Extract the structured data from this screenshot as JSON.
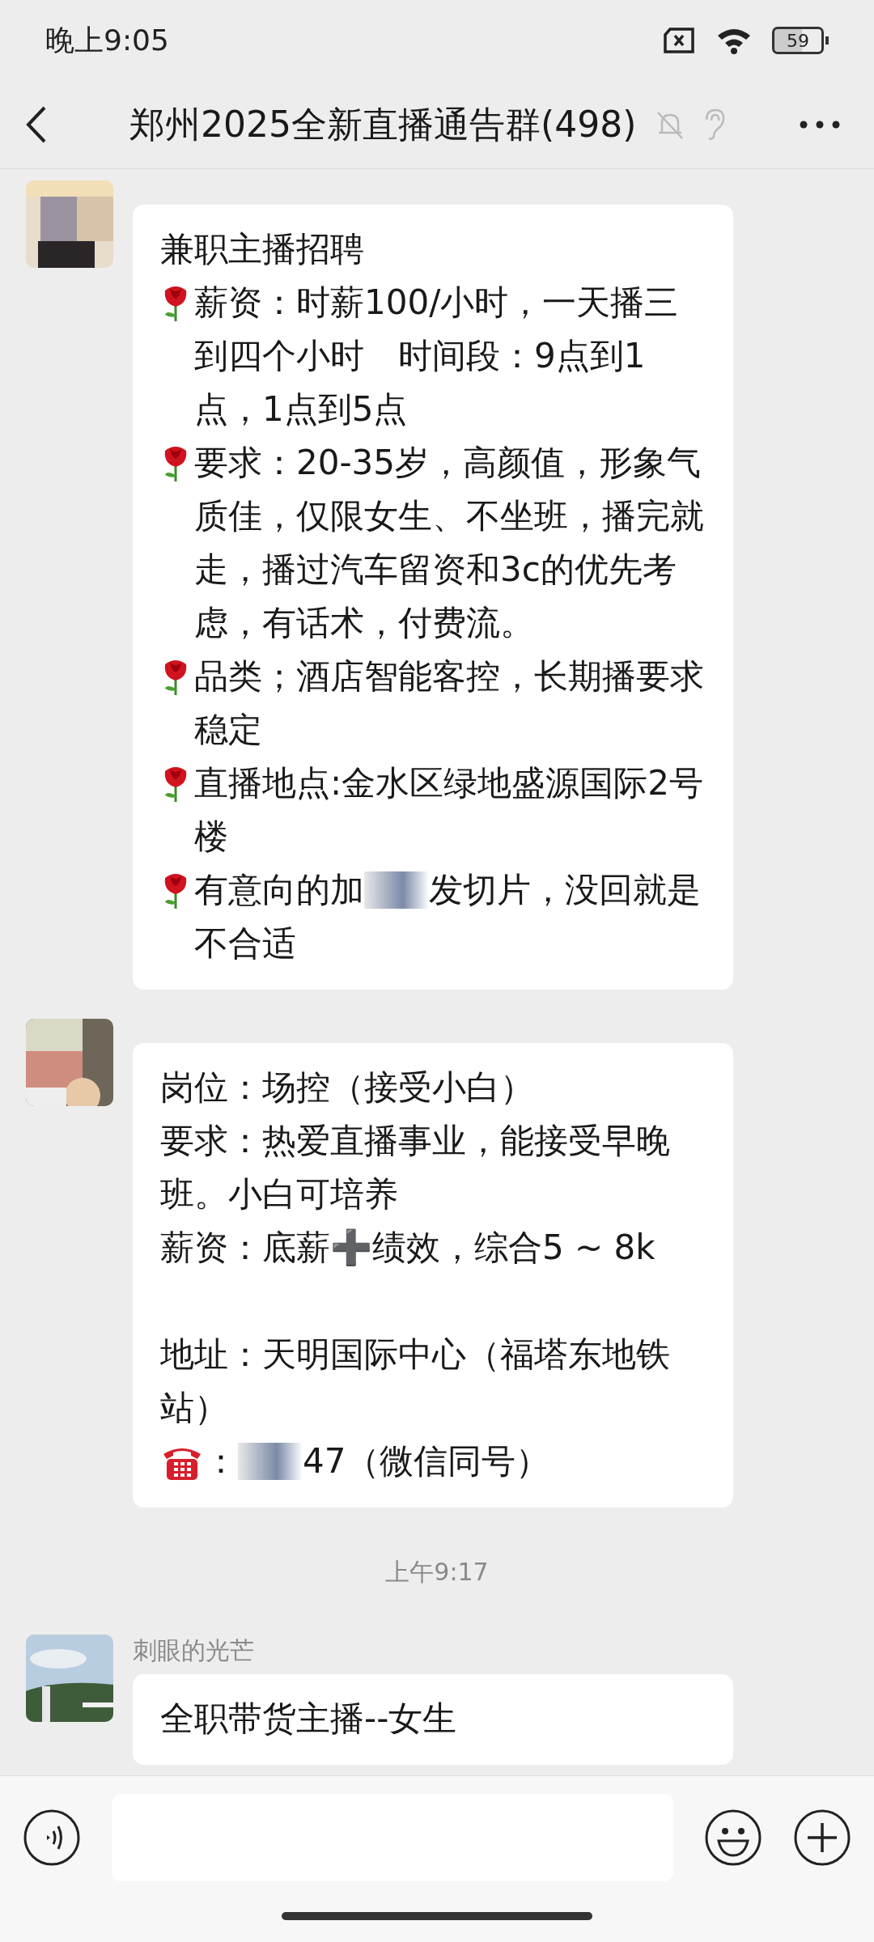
{
  "status_bar": {
    "time": "晚上9:05",
    "battery": "59"
  },
  "header": {
    "title": "郑州2025全新直播通告群(498)"
  },
  "messages": [
    {
      "kind": "message",
      "paragraphs": [
        {
          "kind": "plain",
          "segments": [
            {
              "kind": "text",
              "text": "兼职主播招聘"
            }
          ]
        },
        {
          "kind": "rose",
          "segments": [
            {
              "kind": "text",
              "text": "薪资：时薪100/小时，一天播三到四个小时　时间段：9点到1点，1点到5点"
            }
          ]
        },
        {
          "kind": "rose",
          "segments": [
            {
              "kind": "text",
              "text": "要求：20-35岁，高颜值，形象气质佳，仅限女生、不坐班，播完就走，播过汽车留资和3c的优先考虑，有话术，付费流。"
            }
          ]
        },
        {
          "kind": "rose",
          "segments": [
            {
              "kind": "text",
              "text": "品类；酒店智能客控，长期播要求稳定"
            }
          ]
        },
        {
          "kind": "rose",
          "segments": [
            {
              "kind": "text",
              "text": "直播地点:金水区绿地盛源国际2号楼"
            }
          ]
        },
        {
          "kind": "rose",
          "segments": [
            {
              "kind": "text",
              "text": "有意向的加"
            },
            {
              "kind": "redacted"
            },
            {
              "kind": "text",
              "text": "发切片，没回就是"
            },
            {
              "kind": "text",
              "text": "不合适"
            }
          ]
        }
      ]
    },
    {
      "kind": "message",
      "paragraphs": [
        {
          "kind": "plain",
          "segments": [
            {
              "kind": "text",
              "text": "岗位：场控（接受小白）"
            }
          ]
        },
        {
          "kind": "plain",
          "segments": [
            {
              "kind": "text",
              "text": "要求：热爱直播事业，能接受早晚班。小白可培养"
            }
          ]
        },
        {
          "kind": "plain",
          "segments": [
            {
              "kind": "text",
              "text": "薪资：底薪➕绩效，综合5 ~ 8k"
            }
          ]
        },
        {
          "kind": "blank"
        },
        {
          "kind": "plain",
          "segments": [
            {
              "kind": "text",
              "text": "地址：天明国际中心（福塔东地铁站）"
            }
          ]
        },
        {
          "kind": "telephone",
          "segments": [
            {
              "kind": "text",
              "text": "："
            },
            {
              "kind": "redacted"
            },
            {
              "kind": "text",
              "text": "47（微信同号）"
            }
          ]
        }
      ]
    },
    {
      "kind": "time",
      "text": "上午9:17"
    },
    {
      "kind": "message",
      "sender": "刺眼的光芒",
      "paragraphs": [
        {
          "kind": "plain",
          "segments": [
            {
              "kind": "text",
              "text": "全职带货主播--女生"
            }
          ]
        }
      ]
    }
  ]
}
